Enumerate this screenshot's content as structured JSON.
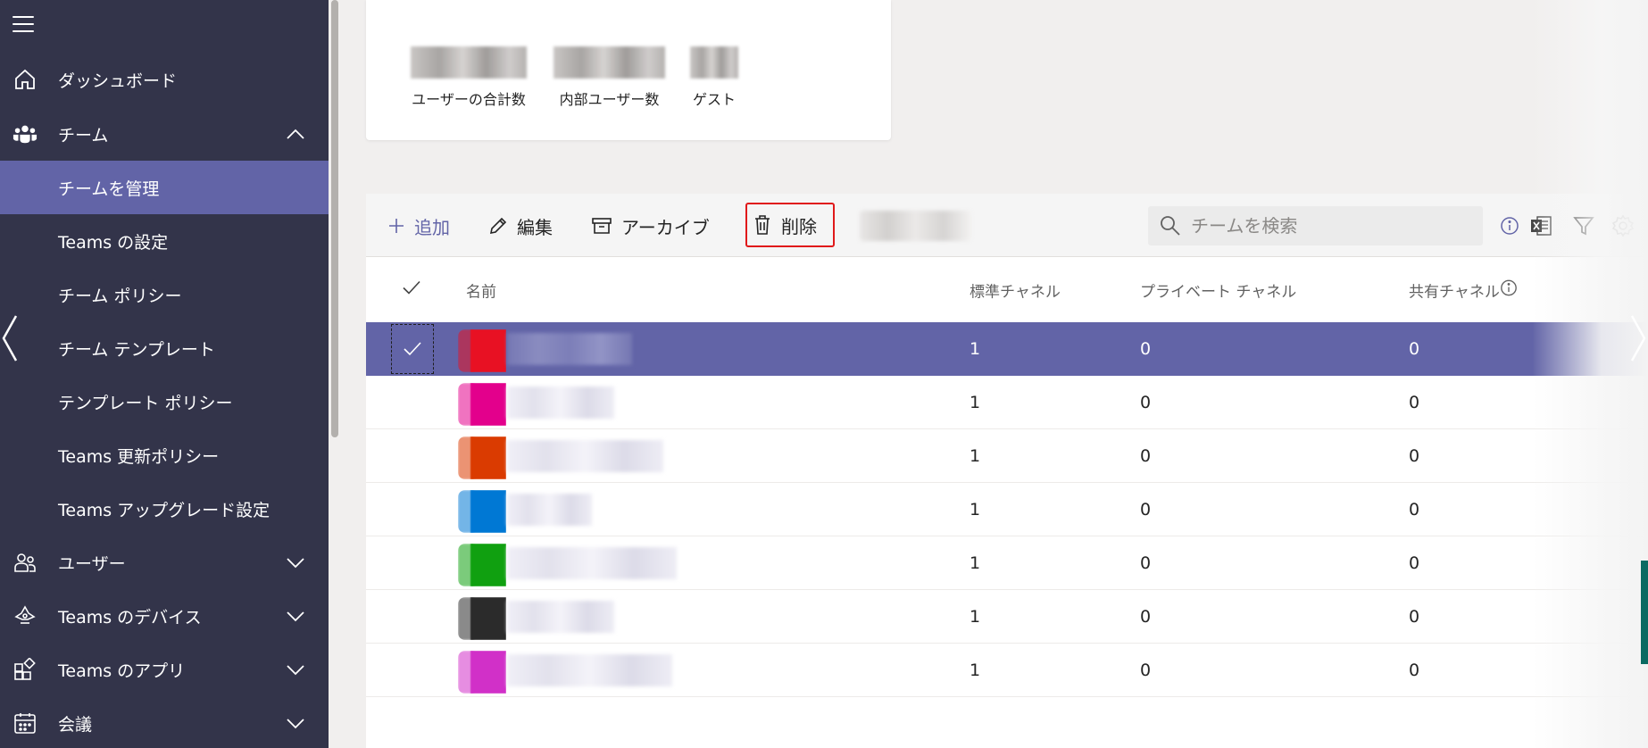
{
  "sidebar": {
    "items": [
      {
        "label": "ダッシュボード",
        "icon": "home-icon"
      },
      {
        "label": "チーム",
        "icon": "teams-icon",
        "expanded": true
      },
      {
        "label": "チームを管理",
        "selected": true
      },
      {
        "label": "Teams の設定"
      },
      {
        "label": "チーム ポリシー"
      },
      {
        "label": "チーム テンプレート"
      },
      {
        "label": "テンプレート ポリシー"
      },
      {
        "label": "Teams 更新ポリシー"
      },
      {
        "label": "Teams アップグレード設定"
      },
      {
        "label": "ユーザー",
        "icon": "users-icon"
      },
      {
        "label": "Teams のデバイス",
        "icon": "devices-icon"
      },
      {
        "label": "Teams のアプリ",
        "icon": "apps-icon"
      },
      {
        "label": "会議",
        "icon": "meetings-icon"
      }
    ]
  },
  "summary": {
    "stats": [
      {
        "label": "ユーザーの合計数"
      },
      {
        "label": "内部ユーザー数"
      },
      {
        "label": "ゲスト"
      }
    ]
  },
  "toolbar": {
    "add_label": "追加",
    "edit_label": "編集",
    "archive_label": "アーカイブ",
    "delete_label": "削除",
    "search_placeholder": "チームを検索"
  },
  "table": {
    "columns": {
      "name": "名前",
      "standard": "標準チャネル",
      "private": "プライベート チャネル",
      "shared": "共有チャネル"
    },
    "rows": [
      {
        "color": "#e81123",
        "std": "1",
        "priv": "0",
        "shared": "0",
        "selected": true
      },
      {
        "color": "#e3008c",
        "std": "1",
        "priv": "0",
        "shared": "0"
      },
      {
        "color": "#da3b01",
        "std": "1",
        "priv": "0",
        "shared": "0"
      },
      {
        "color": "#0078d4",
        "std": "1",
        "priv": "0",
        "shared": "0"
      },
      {
        "color": "#10a010",
        "std": "1",
        "priv": "0",
        "shared": "0"
      },
      {
        "color": "#2b2b2b",
        "std": "1",
        "priv": "0",
        "shared": "0"
      },
      {
        "color": "#d130c8",
        "std": "1",
        "priv": "0",
        "shared": "0"
      }
    ]
  },
  "colors": {
    "sidebar_bg": "#33344a",
    "accent": "#6264a7",
    "highlight_border": "#e0191a"
  }
}
